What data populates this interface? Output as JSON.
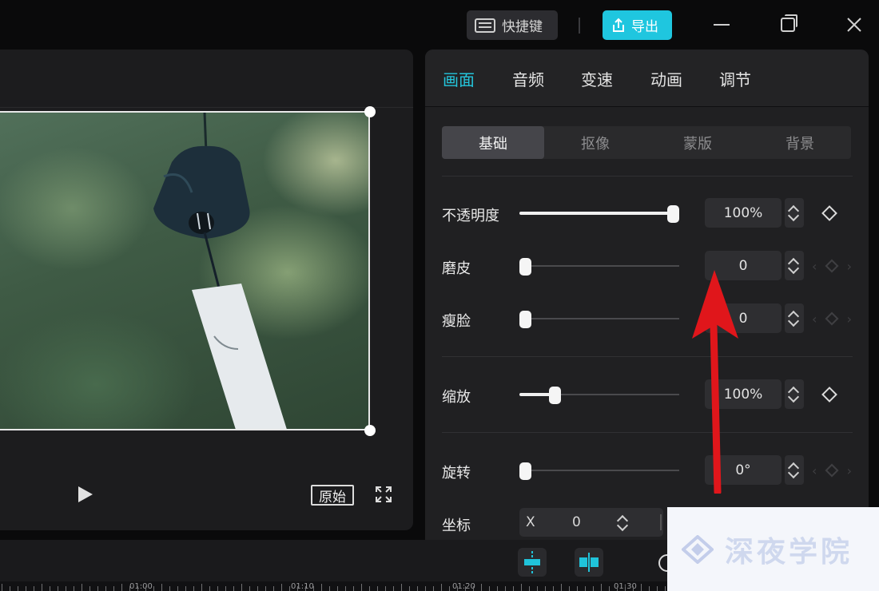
{
  "titlebar": {
    "shortcuts_label": "快捷键",
    "export_label": "导出"
  },
  "preview": {
    "original_label": "原始"
  },
  "tabs": [
    {
      "label": "画面",
      "active": true
    },
    {
      "label": "音频",
      "active": false
    },
    {
      "label": "变速",
      "active": false
    },
    {
      "label": "动画",
      "active": false
    },
    {
      "label": "调节",
      "active": false
    }
  ],
  "subtabs": [
    {
      "label": "基础",
      "active": true
    },
    {
      "label": "抠像",
      "active": false
    },
    {
      "label": "蒙版",
      "active": false
    },
    {
      "label": "背景",
      "active": false
    }
  ],
  "properties": {
    "opacity": {
      "label": "不透明度",
      "value": "100%",
      "level": 1.0
    },
    "smooth": {
      "label": "磨皮",
      "value": "0",
      "level": 0.0
    },
    "slim": {
      "label": "瘦脸",
      "value": "0",
      "level": 0.0
    },
    "scale": {
      "label": "缩放",
      "value": "100%",
      "level": 0.2
    },
    "rotate": {
      "label": "旋转",
      "value": "0°",
      "level": 0.0
    },
    "position": {
      "label": "坐标",
      "x_label": "X",
      "x_value": "0"
    }
  },
  "timeline": {
    "ruler_labels": [
      "01:00",
      "01:10",
      "01:20",
      "01:30"
    ]
  },
  "watermark": {
    "text": "深夜学院"
  },
  "colors": {
    "accent": "#1fc6df",
    "annotation_arrow": "#e0161b",
    "panel_bg": "#202022"
  },
  "icons": [
    "keyboard-icon",
    "export-icon",
    "minimize-icon",
    "maximize-icon",
    "close-icon",
    "play-icon",
    "fullscreen-icon",
    "stepper-icon",
    "keyframe-diamond-icon",
    "split-icon",
    "freeze-icon"
  ]
}
